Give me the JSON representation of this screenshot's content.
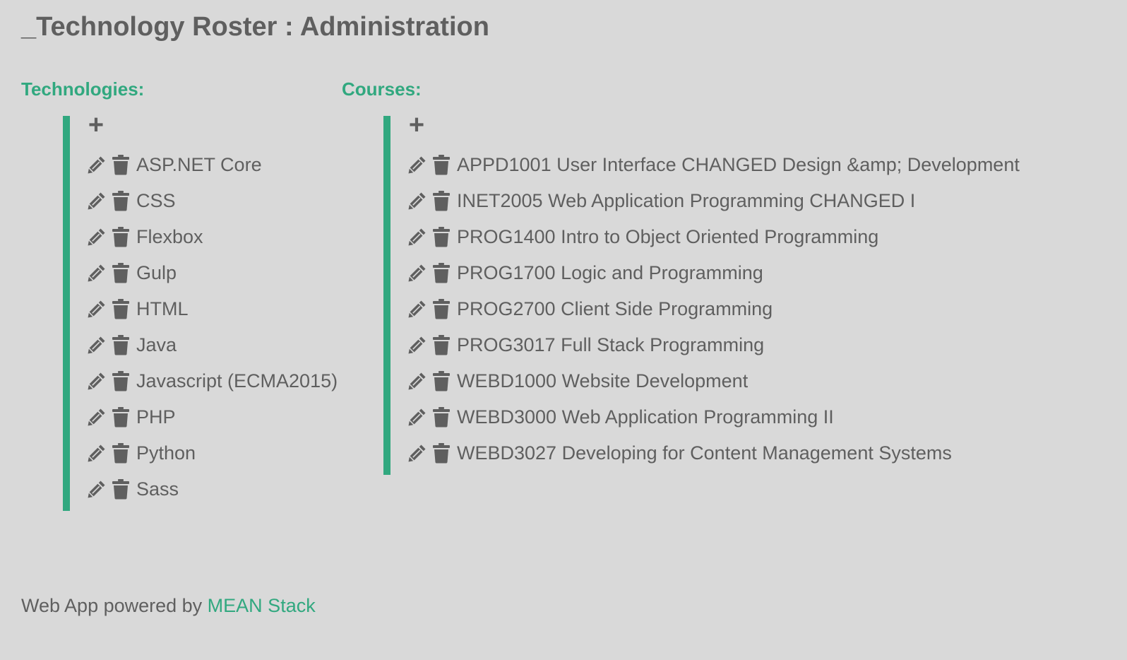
{
  "page": {
    "title": "_Technology Roster : Administration"
  },
  "technologies": {
    "heading": "Technologies:",
    "add_label": "+",
    "items": [
      "ASP.NET Core",
      "CSS",
      "Flexbox",
      "Gulp",
      "HTML",
      "Java",
      "Javascript (ECMA2015)",
      "PHP",
      "Python",
      "Sass"
    ]
  },
  "courses": {
    "heading": "Courses:",
    "add_label": "+",
    "items": [
      "APPD1001 User Interface CHANGED Design &amp; Development",
      "INET2005 Web Application Programming CHANGED I",
      "PROG1400 Intro to Object Oriented Programming",
      "PROG1700 Logic and Programming",
      "PROG2700 Client Side Programming",
      "PROG3017 Full Stack Programming",
      "WEBD1000 Website Development",
      "WEBD3000 Web Application Programming II",
      "WEBD3027 Developing for Content Management Systems"
    ]
  },
  "footer": {
    "text": "Web App powered by ",
    "link_text": "MEAN Stack"
  },
  "icons": {
    "add": "plus-icon",
    "edit": "pencil-icon",
    "delete": "trash-icon"
  },
  "colors": {
    "accent": "#31a87f",
    "text": "#5f5f5f",
    "background": "#d9d9d9"
  }
}
